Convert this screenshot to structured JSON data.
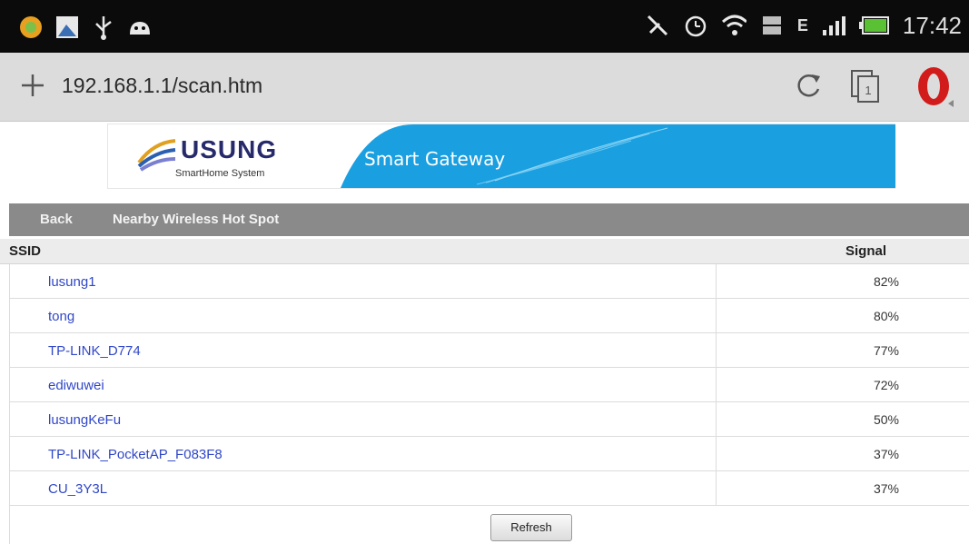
{
  "status_bar": {
    "time": "17:42",
    "network_type": "E",
    "icons": [
      "app-icon",
      "image-icon",
      "usb-icon",
      "android-icon",
      "mute-icon",
      "alarm-icon",
      "wifi-icon",
      "data-icon",
      "signal-icon",
      "battery-icon"
    ]
  },
  "browser": {
    "url": "192.168.1.1/scan.htm",
    "tab_count": "1",
    "icons": [
      "plus-icon",
      "reload-icon",
      "tabs-icon",
      "opera-icon"
    ]
  },
  "banner": {
    "brand": "USUNG",
    "subtitle": "SmartHome System",
    "tagline": "Smart Gateway",
    "colors": {
      "brand_blue": "#1a9fe0",
      "brand_navy": "#262a6b"
    }
  },
  "nav": {
    "back_label": "Back",
    "title": "Nearby Wireless Hot Spot"
  },
  "table": {
    "headers": {
      "ssid": "SSID",
      "signal": "Signal"
    },
    "rows": [
      {
        "ssid": "lusung1",
        "signal": "82%"
      },
      {
        "ssid": "tong",
        "signal": "80%"
      },
      {
        "ssid": "TP-LINK_D774",
        "signal": "77%"
      },
      {
        "ssid": "ediwuwei",
        "signal": "72%"
      },
      {
        "ssid": "lusungKeFu",
        "signal": "50%"
      },
      {
        "ssid": "TP-LINK_PocketAP_F083F8",
        "signal": "37%"
      },
      {
        "ssid": "CU_3Y3L",
        "signal": "37%"
      }
    ]
  },
  "actions": {
    "refresh_label": "Refresh"
  }
}
